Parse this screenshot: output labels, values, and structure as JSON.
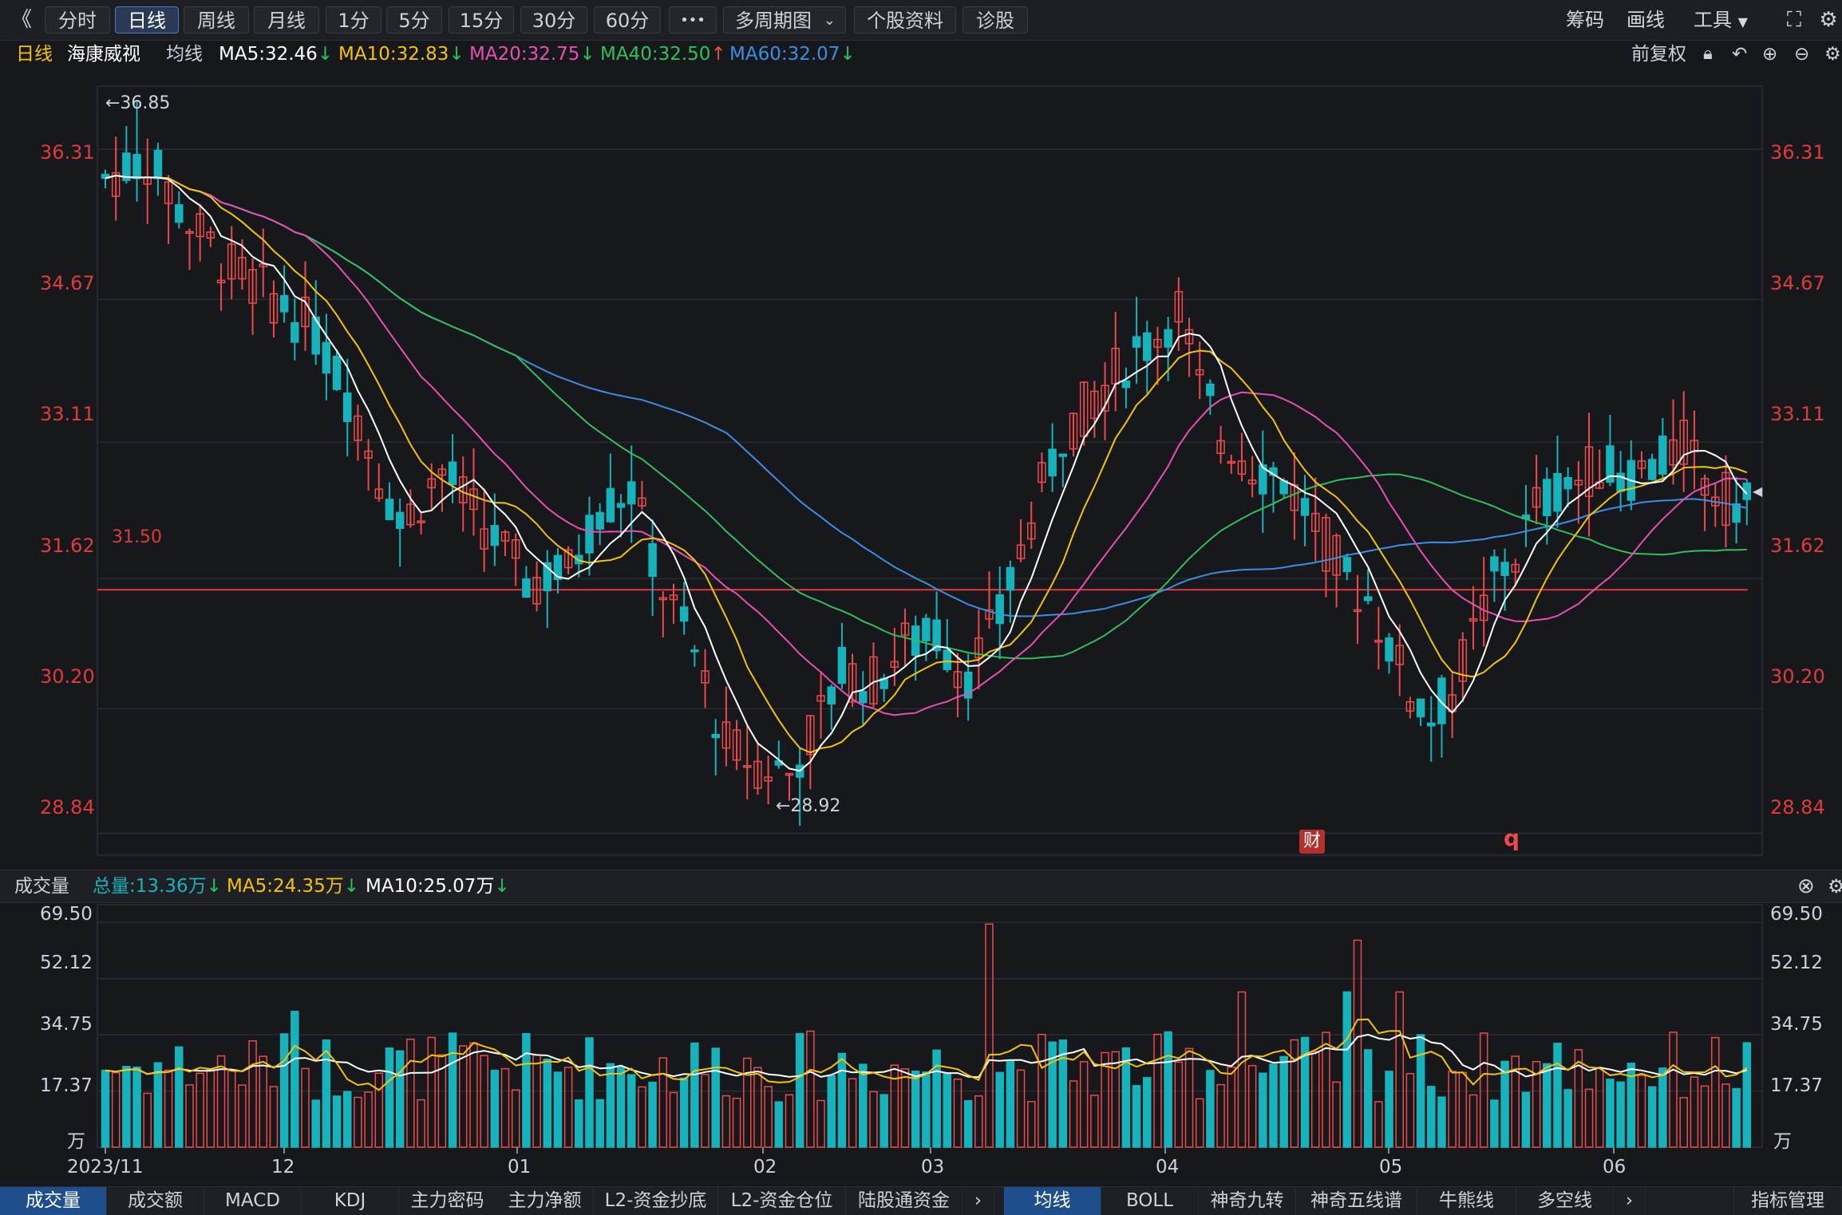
{
  "toolbar": {
    "back": "《",
    "periods": [
      "分时",
      "日线",
      "周线",
      "月线",
      "1分",
      "5分",
      "15分",
      "30分",
      "60分"
    ],
    "more": "•••",
    "multi_period": "多周期图",
    "stock_info": "个股资料",
    "diagnosis": "诊股",
    "chips": "筹码",
    "draw": "画线",
    "tools": "工具"
  },
  "legend": {
    "period": "日线",
    "stock_name": "海康威视",
    "ma_label": "均线",
    "ma5": "MA5:32.46",
    "ma10": "MA10:32.83",
    "ma20": "MA20:32.75",
    "ma40": "MA40:32.50",
    "ma60": "MA60:32.07",
    "adjust": "前复权"
  },
  "colors": {
    "up": "#ee4a4a",
    "down": "#16b3bd",
    "ma5": "#ffffff",
    "ma10": "#f4c20d",
    "ma20": "#e84fb4",
    "ma40": "#2fc05a",
    "ma60": "#3a8ee6",
    "axis_text": "#e03b3b"
  },
  "price_axis": {
    "ticks": [
      "36.31",
      "34.67",
      "33.11",
      "31.62",
      "30.20",
      "28.84"
    ],
    "high_marker": "←36.85",
    "low_marker": "←28.92",
    "hline_label": "31.50",
    "badge_cai": "财",
    "badge_q": "q"
  },
  "volume": {
    "title": "成交量",
    "total": "总量:13.36万",
    "ma5": "MA5:24.35万",
    "ma10": "MA10:25.07万",
    "ticks": [
      "69.50",
      "52.12",
      "34.75",
      "17.37",
      "万"
    ]
  },
  "date_axis": [
    "2023/11",
    "12",
    "01",
    "02",
    "03",
    "04",
    "05",
    "06"
  ],
  "bottom_tabs_left": [
    "成交量",
    "成交额",
    "MACD",
    "KDJ",
    "主力密码",
    "主力净额",
    "L2-资金抄底",
    "L2-资金仓位",
    "陆股通资金"
  ],
  "bottom_tabs_right": [
    "均线",
    "BOLL",
    "神奇九转",
    "神奇五线谱",
    "牛熊线",
    "多空线"
  ],
  "indicator_manage": "指标管理",
  "chart_data": {
    "type": "candlestick",
    "stock": "海康威视",
    "period": "日线",
    "ylim": [
      28.6,
      37.0
    ],
    "horizontal_line": 31.5,
    "high": 36.85,
    "low": 28.92,
    "months": [
      "2023/11",
      "12",
      "01",
      "02",
      "03",
      "04",
      "05",
      "06"
    ],
    "volume_ylim": [
      0,
      75
    ],
    "volume_unit": "万"
  }
}
